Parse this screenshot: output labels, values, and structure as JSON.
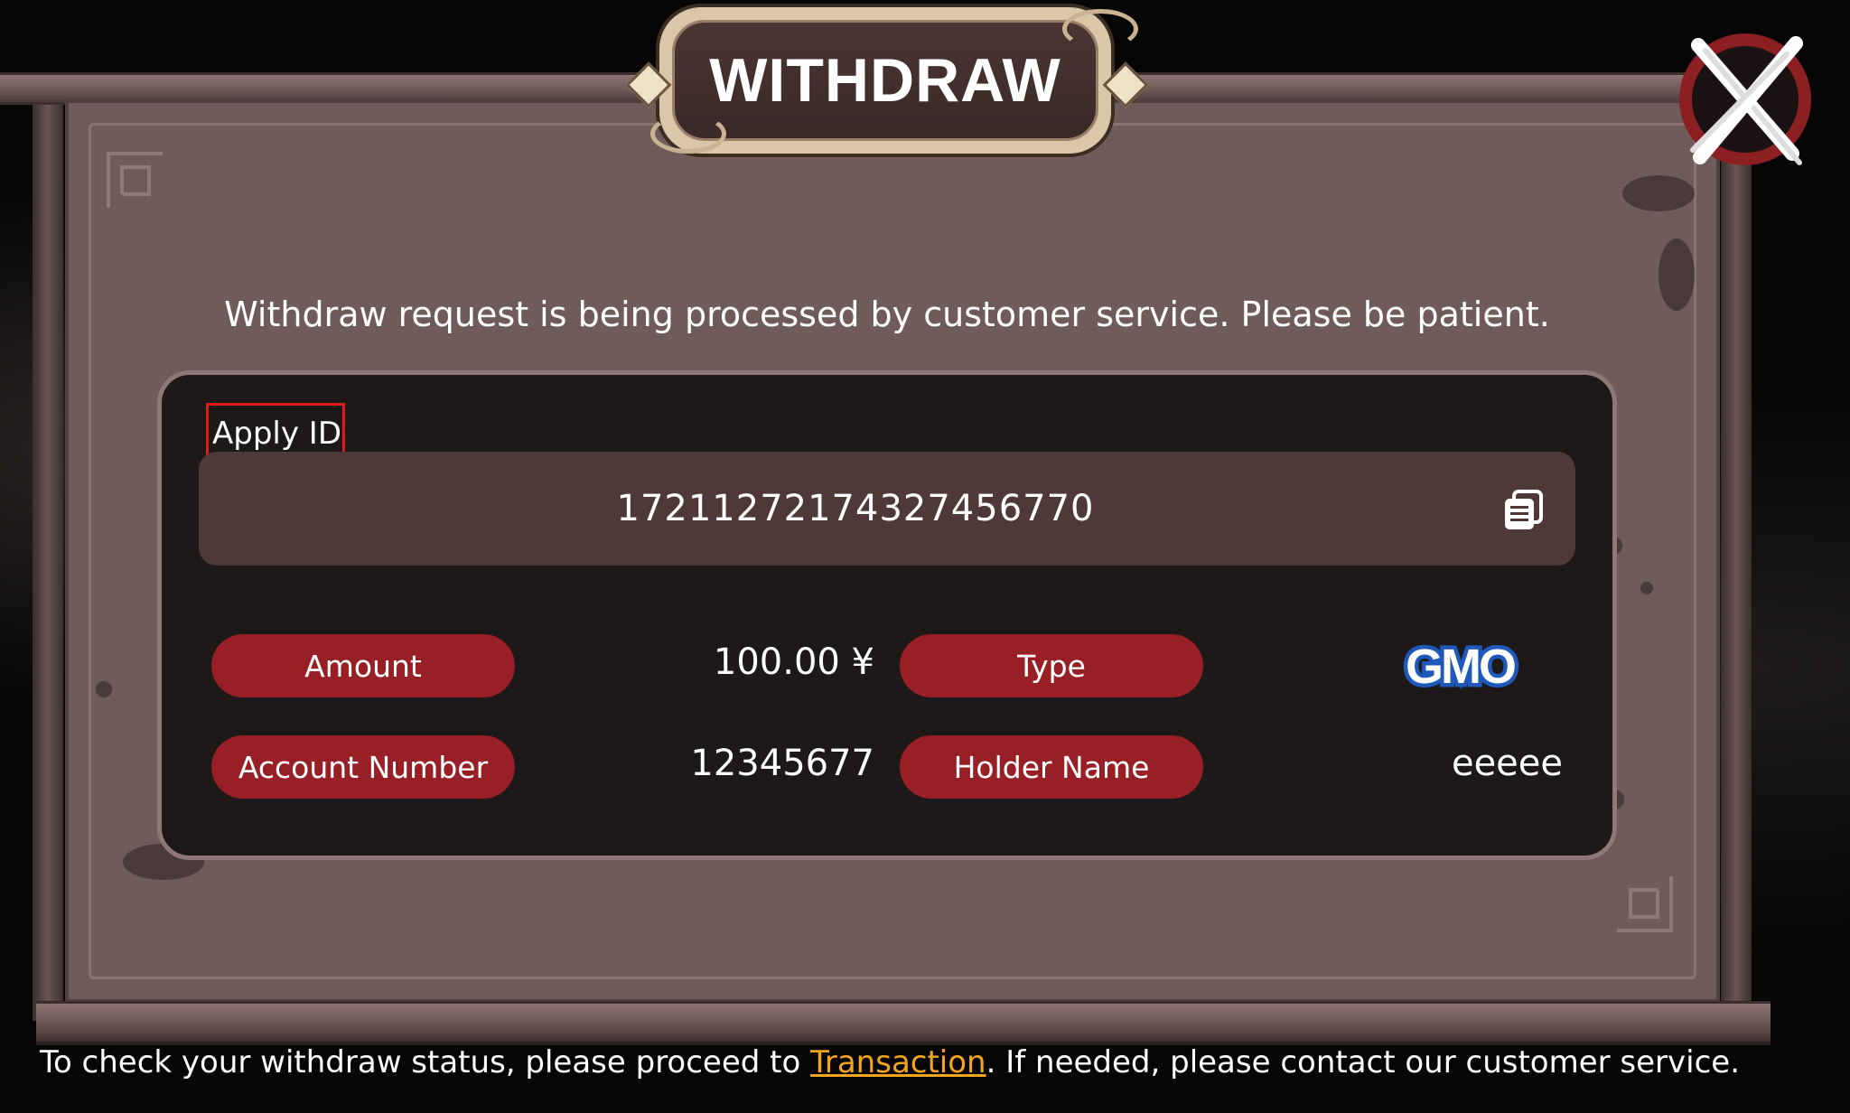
{
  "dialog": {
    "title": "WITHDRAW",
    "close_icon": "close-x-icon"
  },
  "message": "Withdraw request is being processed by customer service. Please be patient.",
  "apply": {
    "label": "Apply ID",
    "value": "17211272174327456770",
    "copy_icon": "copy-icon"
  },
  "details": {
    "amount_label": "Amount",
    "amount_value": "100.00 ¥",
    "type_label": "Type",
    "type_logo_text": "GMO",
    "account_label": "Account Number",
    "account_value": "12345677",
    "holder_label": "Holder Name",
    "holder_value": "eeeee"
  },
  "footer": {
    "before": "To check your withdraw status, please proceed to ",
    "link": "Transaction",
    "after": ". If needed, please contact our customer service."
  },
  "colors": {
    "board": "#705b5b",
    "panel": "#1c1918",
    "pill": "#981f25",
    "link": "#f2a51d",
    "highlight_box": "#e01b1b",
    "gmo_blue": "#1e58b8"
  }
}
